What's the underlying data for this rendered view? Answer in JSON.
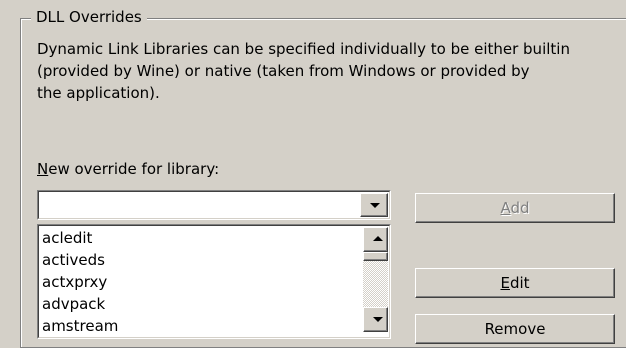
{
  "group": {
    "title": "DLL Overrides",
    "description_lines": [
      "Dynamic Link Libraries can be specified individually to be either builtin",
      "(provided by Wine) or native (taken from Windows or provided by",
      "the application)."
    ]
  },
  "override": {
    "label_accel": "N",
    "label_rest": "ew override for library:",
    "value": ""
  },
  "library_list": {
    "items": [
      "acledit",
      "activeds",
      "actxprxy",
      "advpack",
      "amstream"
    ]
  },
  "buttons": {
    "add_accel": "A",
    "add_rest": "dd",
    "edit_accel": "E",
    "edit_rest": "dit",
    "remove_label": "Remove"
  }
}
